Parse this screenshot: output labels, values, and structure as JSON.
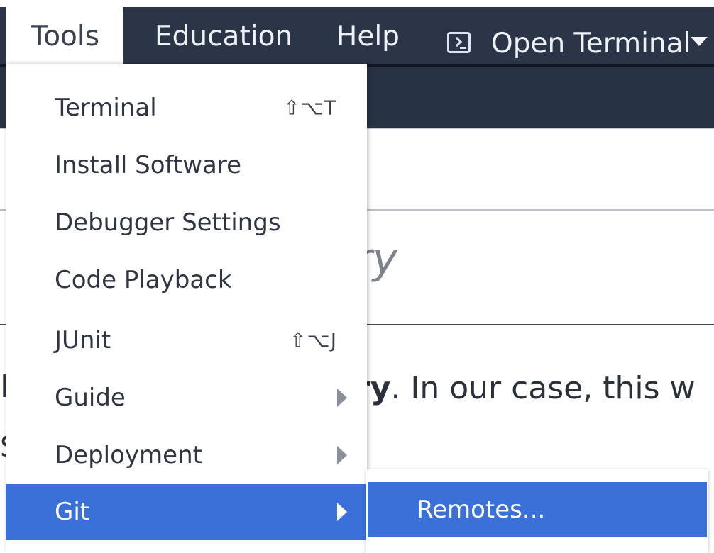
{
  "menubar": {
    "items": [
      {
        "label": "Tools",
        "active": true
      },
      {
        "label": "Education"
      },
      {
        "label": "Help"
      }
    ],
    "open_terminal": {
      "label": "Open Terminal",
      "icon": "terminal-icon"
    }
  },
  "document": {
    "heading_fragment": "ry",
    "body_bold": "ry",
    "body_rest": ". In our case, this w",
    "left_fragment_s": "S",
    "left_fragment_i": "I"
  },
  "dropdown": {
    "items": [
      {
        "label": "Terminal",
        "shortcut": "⇧⌥T"
      },
      {
        "label": "Install Software"
      },
      {
        "label": "Debugger Settings"
      },
      {
        "label": "Code Playback"
      },
      {
        "label": "JUnit",
        "shortcut": "⇧⌥J"
      },
      {
        "label": "Guide",
        "submenu": true
      },
      {
        "label": "Deployment",
        "submenu": true
      },
      {
        "label": "Git",
        "submenu": true,
        "selected": true
      }
    ]
  },
  "submenu": {
    "items": [
      {
        "label": "Remotes...",
        "selected": true
      }
    ]
  },
  "colors": {
    "menubar_bg": "#2c3547",
    "selected_bg": "#3b70d9"
  }
}
